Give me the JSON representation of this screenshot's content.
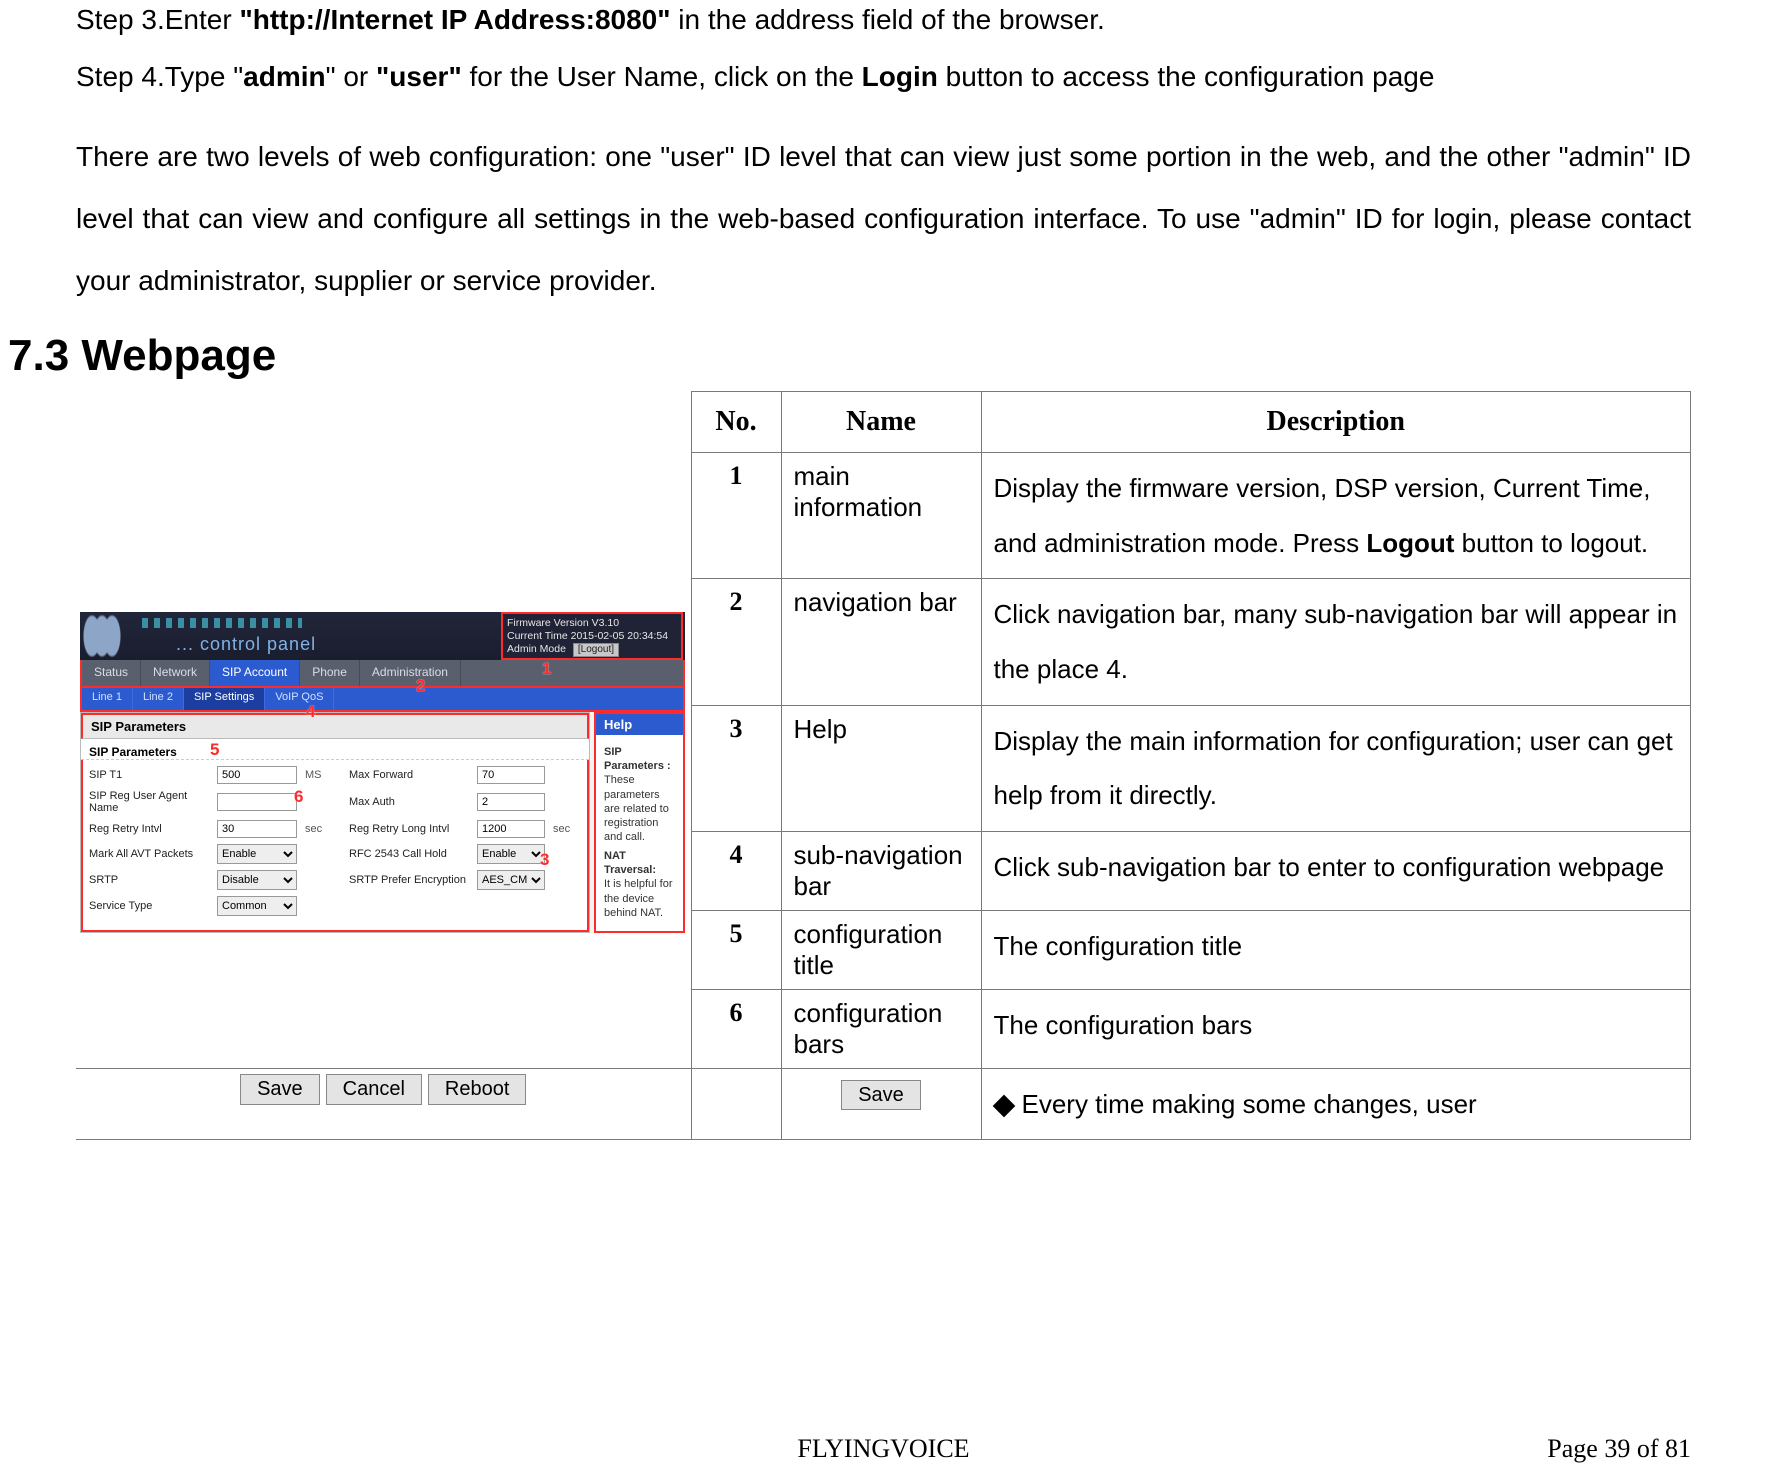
{
  "steps": {
    "s3_prefix": "Step 3.Enter ",
    "s3_bold": "\"http://Internet IP Address:8080\"",
    "s3_suffix": " in the address field of the browser.",
    "s4_a": "Step 4.Type \"",
    "s4_b": "admin",
    "s4_c": "\" or ",
    "s4_d": "\"user\"",
    "s4_e": " for the User Name, click on the ",
    "s4_f": "Login",
    "s4_g": " button to access the configuration page"
  },
  "para": "There are two levels of web configuration: one \"user\" ID level that can view just some portion in the web, and the other \"admin\" ID level that can view and configure all settings in the web-based configuration interface. To use \"admin\" ID for login, please contact your administrator, supplier or service provider.",
  "section_heading": "7.3   Webpage",
  "table_headers": {
    "no": "No.",
    "name": "Name",
    "desc": "Description"
  },
  "rows": [
    {
      "no": "1",
      "name": "main information",
      "desc_a": "Display the firmware version, DSP version, Current Time, and administration mode. Press ",
      "desc_b": "Logout",
      "desc_c": " button to logout."
    },
    {
      "no": "2",
      "name": "navigation bar",
      "desc_a": "Click navigation bar, many sub-navigation bar will appear in the place 4.",
      "desc_b": "",
      "desc_c": ""
    },
    {
      "no": "3",
      "name": "Help",
      "desc_a": "Display the main information for configuration; user can get help from it directly.",
      "desc_b": "",
      "desc_c": ""
    },
    {
      "no": "4",
      "name": "sub-navigation bar",
      "desc_a": "Click sub-navigation bar to enter to configuration webpage",
      "desc_b": "",
      "desc_c": ""
    },
    {
      "no": "5",
      "name": "configuration title",
      "desc_a": "The configuration title",
      "desc_b": "",
      "desc_c": ""
    },
    {
      "no": "6",
      "name": "configuration bars",
      "desc_a": "The configuration bars",
      "desc_b": "",
      "desc_c": ""
    }
  ],
  "last_row_desc": "Every  time  making  some  changes,  user",
  "shot": {
    "cp_label": "... control panel",
    "info_fw": "Firmware Version V3.10",
    "info_time": "Current Time 2015-02-05 20:34:54",
    "info_mode_label": "Admin Mode",
    "logout": "[Logout]",
    "tabs": [
      "Status",
      "Network",
      "SIP Account",
      "Phone",
      "Administration"
    ],
    "active_tab_index": 2,
    "subtabs": [
      "Line 1",
      "Line 2",
      "SIP Settings",
      "VoIP QoS"
    ],
    "active_subtab_index": 2,
    "sip_title": "SIP Parameters",
    "sip_sub": "SIP Parameters",
    "form": {
      "r1": {
        "l1": "SIP T1",
        "v1": "500",
        "u1": "MS",
        "l2": "Max Forward",
        "v2": "70",
        "u2": ""
      },
      "r2": {
        "l1": "SIP Reg User Agent Name",
        "v1": "",
        "u1": "",
        "l2": "Max Auth",
        "v2": "2",
        "u2": ""
      },
      "r3": {
        "l1": "Reg Retry Intvl",
        "v1": "30",
        "u1": "sec",
        "l2": "Reg Retry Long Intvl",
        "v2": "1200",
        "u2": "sec"
      },
      "r4": {
        "l1": "Mark All AVT Packets",
        "s1": "Enable",
        "u1": "",
        "l2": "RFC 2543 Call Hold",
        "s2": "Enable",
        "u2": ""
      },
      "r5": {
        "l1": "SRTP",
        "s1": "Disable",
        "u1": "",
        "l2": "SRTP Prefer Encryption",
        "s2": "AES_CM",
        "u2": ""
      },
      "r6": {
        "l1": "Service Type",
        "s1": "Common",
        "u1": "",
        "l2": "",
        "s2": "",
        "u2": ""
      }
    },
    "help": {
      "title": "Help",
      "h1": "SIP Parameters :",
      "p1": "These parameters are related to registration and call.",
      "h2": "NAT Traversal:",
      "p2": "It is helpful for the device behind NAT."
    },
    "callouts": {
      "c1": "1",
      "c2": "2",
      "c3": "3",
      "c4": "4",
      "c5": "5",
      "c6": "6"
    }
  },
  "buttons_fig1": [
    "Save",
    "Cancel",
    "Reboot"
  ],
  "buttons_fig2": [
    "Save"
  ],
  "footer": {
    "brand": "FLYINGVOICE",
    "page": "Page  39  of  81"
  }
}
